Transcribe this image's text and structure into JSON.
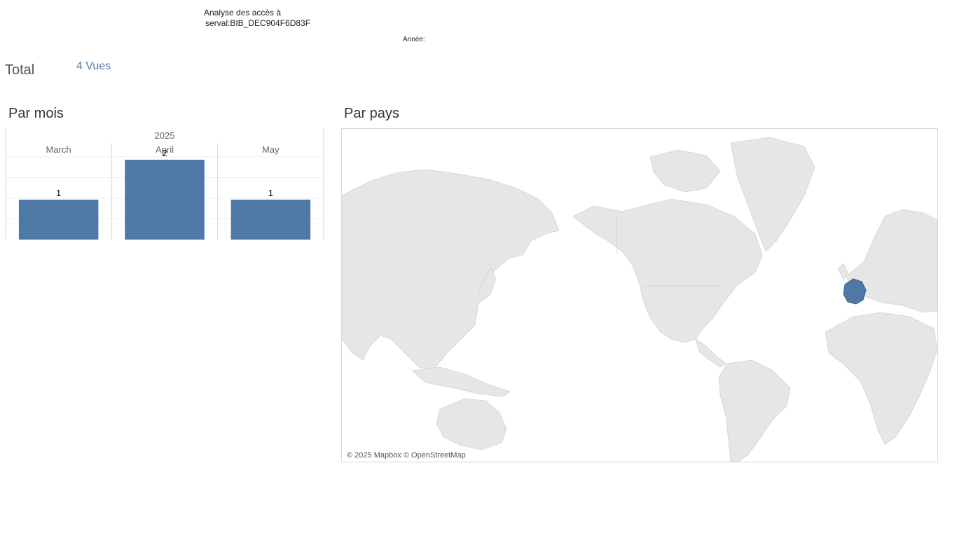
{
  "header": {
    "title_line1": "Analyse des accès à",
    "title_line2": "serval:BIB_DEC904F6D83F",
    "year_filter_label": "Année:"
  },
  "total": {
    "label": "Total",
    "value": "4 Vues"
  },
  "sections": {
    "by_month": "Par mois",
    "by_country": "Par pays"
  },
  "chart_data": {
    "type": "bar",
    "title": "",
    "group_label": "2025",
    "categories": [
      "March",
      "April",
      "May"
    ],
    "values": [
      1,
      2,
      1
    ],
    "ylim": [
      0,
      2
    ],
    "grid": true,
    "bar_color": "#4e79a7"
  },
  "map": {
    "credit": "© 2025 Mapbox © OpenStreetMap",
    "highlighted_country": "France",
    "highlight_color": "#4e79a7",
    "land_color": "#e6e6e6"
  }
}
